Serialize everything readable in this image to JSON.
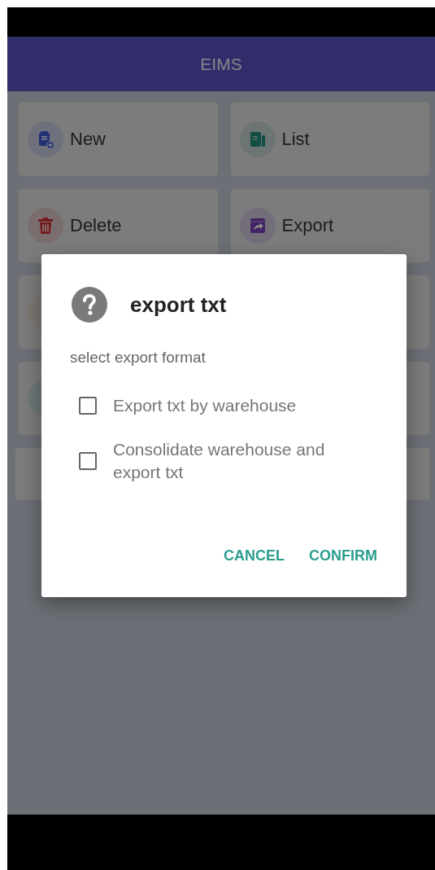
{
  "app_bar": {
    "title": "EIMS"
  },
  "menu": [
    {
      "kind": "tile",
      "label": "New"
    },
    {
      "kind": "tile",
      "label": "List"
    },
    {
      "kind": "tile",
      "label": "Delete"
    },
    {
      "kind": "tile",
      "label": "Export"
    },
    {
      "kind": "tile"
    },
    {
      "kind": "tile"
    },
    {
      "kind": "tile"
    },
    {
      "kind": "tile"
    },
    {
      "kind": "wide"
    }
  ],
  "dialog": {
    "title": "export txt",
    "message": "select export format",
    "options": [
      {
        "label": "Export txt by warehouse",
        "checked": false
      },
      {
        "label": "Consolidate warehouse and export txt",
        "checked": false
      }
    ],
    "buttons": [
      {
        "label": "CANCEL"
      },
      {
        "label": "CONFIRM"
      }
    ]
  }
}
